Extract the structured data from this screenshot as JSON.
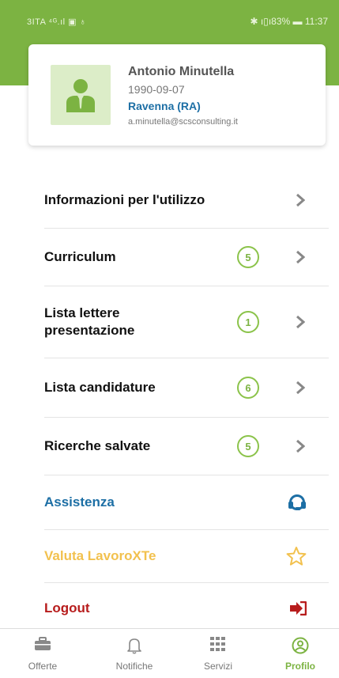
{
  "status_bar": {
    "left": "3ITA ⁴ᴳ.ıl ▣ ♁",
    "right": "✱ ı▯ı83% ▬ 11:37"
  },
  "profile": {
    "name": "Antonio Minutella",
    "birth_date": "1990-09-07",
    "city": "Ravenna (RA)",
    "email": "a.minutella@scsconsulting.it"
  },
  "menu": [
    {
      "label": "Informazioni per l'utilizzo",
      "badge": null
    },
    {
      "label": "Curriculum",
      "badge": "5"
    },
    {
      "label": "Lista lettere presentazione",
      "badge": "1"
    },
    {
      "label": "Lista candidature",
      "badge": "6"
    },
    {
      "label": "Ricerche salvate",
      "badge": "5"
    }
  ],
  "actions": [
    {
      "label": "Assistenza",
      "icon": "headset-icon",
      "color": "#1d6fa5"
    },
    {
      "label": "Valuta LavoroXTe",
      "icon": "star-icon",
      "color": "#f2c14e"
    },
    {
      "label": "Logout",
      "icon": "logout-icon",
      "color": "#b71c1c"
    }
  ],
  "tabs": [
    {
      "label": "Offerte",
      "icon": "briefcase-icon",
      "active": false
    },
    {
      "label": "Notifiche",
      "icon": "bell-icon",
      "active": false
    },
    {
      "label": "Servizi",
      "icon": "grid-icon",
      "active": false
    },
    {
      "label": "Profilo",
      "icon": "user-circle-icon",
      "active": true
    }
  ],
  "colors": {
    "accent": "#7cb342",
    "badge_border": "#8bc34a"
  }
}
